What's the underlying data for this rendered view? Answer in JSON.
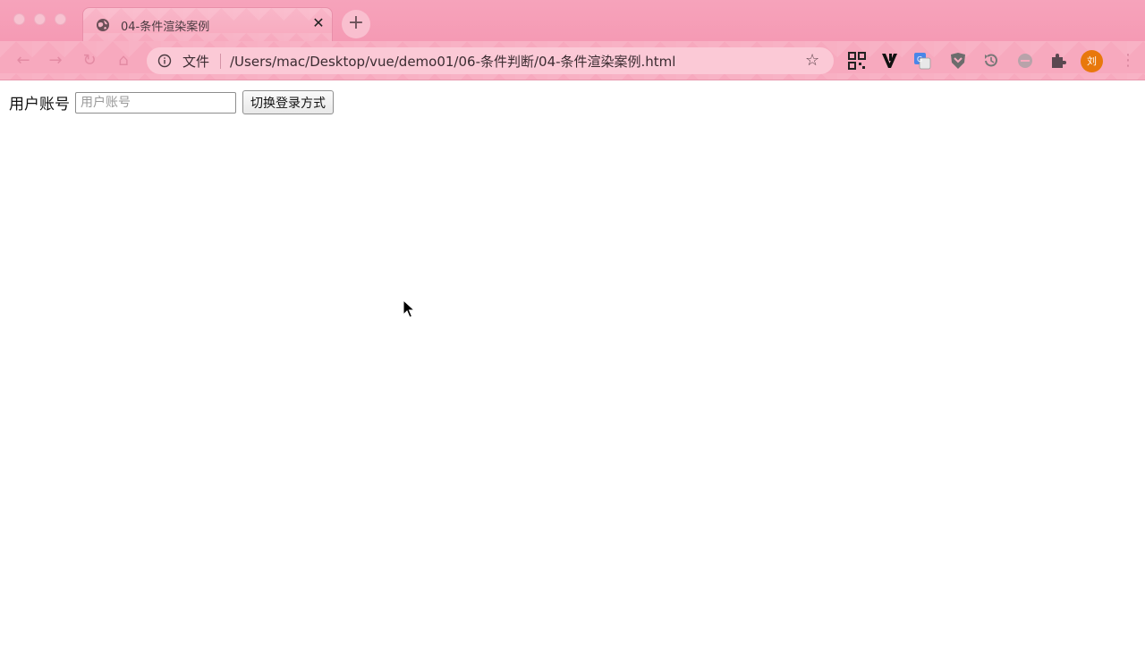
{
  "browser": {
    "tab_title": "04-条件渲染案例",
    "tab_close": "✕",
    "new_tab": "+",
    "address_scheme_label": "文件",
    "address_url": "/Users/mac/Desktop/vue/demo01/06-条件判断/04-条件渲染案例.html",
    "avatar_text": "刘",
    "nav": {
      "back": "←",
      "forward": "→",
      "reload": "↻",
      "home": "⌂",
      "star": "☆",
      "menu": "⋮"
    }
  },
  "page": {
    "account_label": "用户账号",
    "account_input_placeholder": "用户账号",
    "account_input_value": "",
    "switch_button_label": "切换登录方式"
  },
  "colors": {
    "theme_pink": "#f7a9be",
    "avatar_orange": "#e8780c"
  }
}
